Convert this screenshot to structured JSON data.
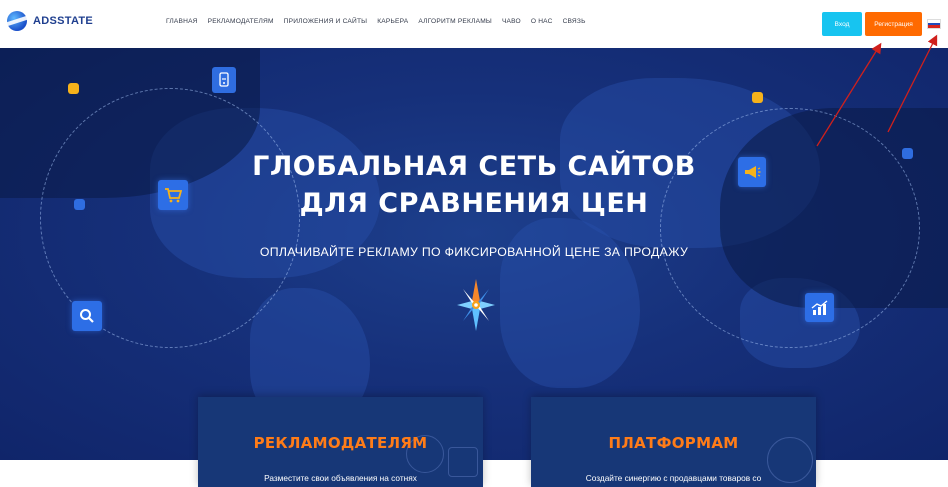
{
  "header": {
    "logo_text": "ADSSTATE",
    "nav": [
      {
        "label": "ГЛАВНАЯ"
      },
      {
        "label": "РЕКЛАМОДАТЕЛЯМ"
      },
      {
        "label": "ПРИЛОЖЕНИЯ И САЙТЫ"
      },
      {
        "label": "КАРЬЕРА"
      },
      {
        "label": "АЛГОРИТМ РЕКЛАМЫ"
      },
      {
        "label": "ЧАВО"
      },
      {
        "label": "О НАС"
      },
      {
        "label": "СВЯЗЬ"
      }
    ],
    "login_label": "Вход",
    "register_label": "Регистрация",
    "language_flag": "ru-flag-icon"
  },
  "hero": {
    "title_line1": "ГЛОБАЛЬНАЯ СЕТЬ САЙТОВ",
    "title_line2": "ДЛЯ СРАВНЕНИЯ ЦЕН",
    "subtitle": "ОПЛАЧИВАЙТЕ РЕКЛАМУ ПО ФИКСИРОВАННОЙ ЦЕНЕ ЗА ПРОДАЖУ",
    "icons": [
      "touch-phone-icon",
      "cart-icon",
      "search-icon",
      "megaphone-icon",
      "chart-icon",
      "compass-icon"
    ]
  },
  "cards": [
    {
      "title": "РЕКЛАМОДАТЕЛЯМ",
      "text": "Разместите свои объявления на сотнях"
    },
    {
      "title": "ПЛАТФОРМАМ",
      "text": "Создайте синергию с продавцами товаров со"
    }
  ],
  "colors": {
    "accent_orange": "#ff6a00",
    "login_cyan": "#17c4f0",
    "hero_blue": "#16307a",
    "card_title_orange": "#ff7c18",
    "annotation_arrow": "#d0201c"
  }
}
